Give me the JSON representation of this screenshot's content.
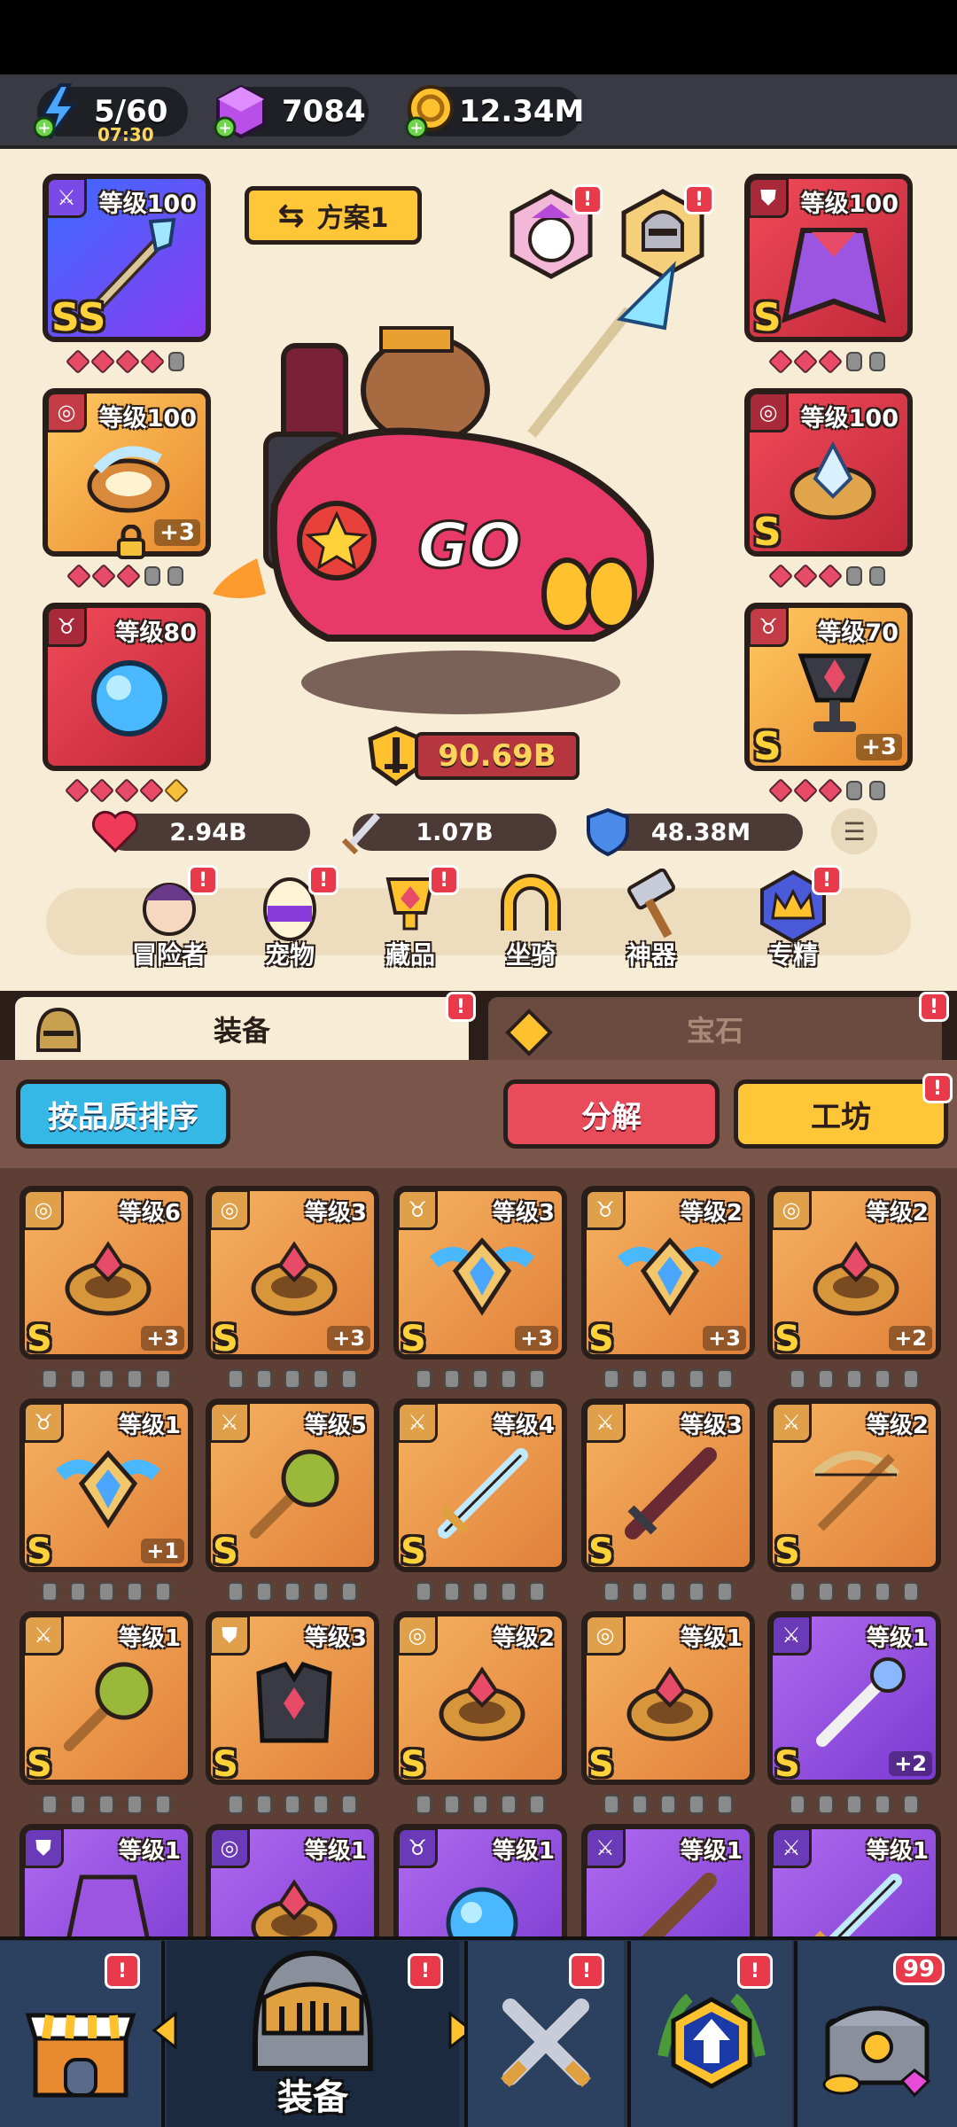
{
  "resources": {
    "energy": {
      "value": "5/60",
      "timer": "07:30"
    },
    "gems": {
      "value": "7084"
    },
    "gold": {
      "value": "12.34M"
    }
  },
  "hero": {
    "plan_label": "方案1",
    "equipment_left": [
      {
        "level": "等级100",
        "grade": "SS",
        "plus": "",
        "gems": [
          "r",
          "r",
          "r",
          "r",
          "l"
        ]
      },
      {
        "level": "等级100",
        "grade": "",
        "plus": "+3",
        "gems": [
          "r",
          "r",
          "r",
          "l",
          "l"
        ]
      },
      {
        "level": "等级80",
        "grade": "",
        "plus": "",
        "gems": [
          "r",
          "r",
          "r",
          "r",
          "y"
        ]
      }
    ],
    "equipment_right": [
      {
        "level": "等级100",
        "grade": "S",
        "plus": "",
        "gems": [
          "r",
          "r",
          "r",
          "l",
          "l"
        ]
      },
      {
        "level": "等级100",
        "grade": "S",
        "plus": "",
        "gems": [
          "r",
          "r",
          "r",
          "l",
          "l"
        ]
      },
      {
        "level": "等级70",
        "grade": "S",
        "plus": "+3",
        "gems": [
          "r",
          "r",
          "r",
          "l",
          "l"
        ]
      }
    ],
    "power": "90.69B",
    "stats": {
      "hp": "2.94B",
      "attack": "1.07B",
      "defense": "48.38M"
    }
  },
  "hero_nav": [
    {
      "label": "冒险者",
      "icon": "adventurer-icon"
    },
    {
      "label": "宠物",
      "icon": "pet-egg-icon"
    },
    {
      "label": "藏品",
      "icon": "collection-trophy-icon"
    },
    {
      "label": "坐骑",
      "icon": "mount-horseshoe-icon"
    },
    {
      "label": "神器",
      "icon": "artifact-hammer-icon"
    },
    {
      "label": "专精",
      "icon": "mastery-crown-icon"
    }
  ],
  "tabs": {
    "equipment": "装备",
    "gems": "宝石"
  },
  "toolbar": {
    "sort": "按品质排序",
    "decompose": "分解",
    "workshop": "工坊"
  },
  "inventory": [
    {
      "level": "等级6",
      "grade": "S",
      "plus": "+3",
      "tier": "orange",
      "item": "ring"
    },
    {
      "level": "等级3",
      "grade": "S",
      "plus": "+3",
      "tier": "orange",
      "item": "ring"
    },
    {
      "level": "等级3",
      "grade": "S",
      "plus": "+3",
      "tier": "orange",
      "item": "winged-amulet"
    },
    {
      "level": "等级2",
      "grade": "S",
      "plus": "+3",
      "tier": "orange",
      "item": "winged-amulet"
    },
    {
      "level": "等级2",
      "grade": "S",
      "plus": "+2",
      "tier": "orange",
      "item": "ring"
    },
    {
      "level": "等级1",
      "grade": "S",
      "plus": "+1",
      "tier": "orange",
      "item": "winged-amulet"
    },
    {
      "level": "等级5",
      "grade": "S",
      "plus": "",
      "tier": "orange",
      "item": "mace"
    },
    {
      "level": "等级4",
      "grade": "S",
      "plus": "",
      "tier": "orange",
      "item": "sword"
    },
    {
      "level": "等级3",
      "grade": "S",
      "plus": "",
      "tier": "orange",
      "item": "dark-sword"
    },
    {
      "level": "等级2",
      "grade": "S",
      "plus": "",
      "tier": "orange",
      "item": "crossbow"
    },
    {
      "level": "等级1",
      "grade": "S",
      "plus": "",
      "tier": "orange",
      "item": "mace"
    },
    {
      "level": "等级3",
      "grade": "S",
      "plus": "",
      "tier": "orange",
      "item": "armor"
    },
    {
      "level": "等级2",
      "grade": "S",
      "plus": "",
      "tier": "orange",
      "item": "ring"
    },
    {
      "level": "等级1",
      "grade": "S",
      "plus": "",
      "tier": "orange",
      "item": "ring"
    },
    {
      "level": "等级1",
      "grade": "S",
      "plus": "+2",
      "tier": "purple",
      "item": "bone-wand"
    },
    {
      "level": "等级1",
      "grade": "",
      "plus": "",
      "tier": "purple",
      "item": "cloak"
    },
    {
      "level": "等级1",
      "grade": "",
      "plus": "",
      "tier": "purple",
      "item": "ring"
    },
    {
      "level": "等级1",
      "grade": "",
      "plus": "",
      "tier": "purple",
      "item": "orb"
    },
    {
      "level": "等级1",
      "grade": "",
      "plus": "",
      "tier": "purple",
      "item": "wood-sword"
    },
    {
      "level": "等级1",
      "grade": "",
      "plus": "",
      "tier": "purple",
      "item": "sword"
    }
  ],
  "bottom_nav": {
    "active_label": "装备",
    "chest_count": "99"
  },
  "colors": {
    "orange_tier": "#f0a24a",
    "purple_tier": "#8b4fd8",
    "badge_red": "#e83a4a",
    "sort_btn": "#35b8e6",
    "decompose_btn": "#e84c5a",
    "workshop_btn": "#ffc638"
  }
}
